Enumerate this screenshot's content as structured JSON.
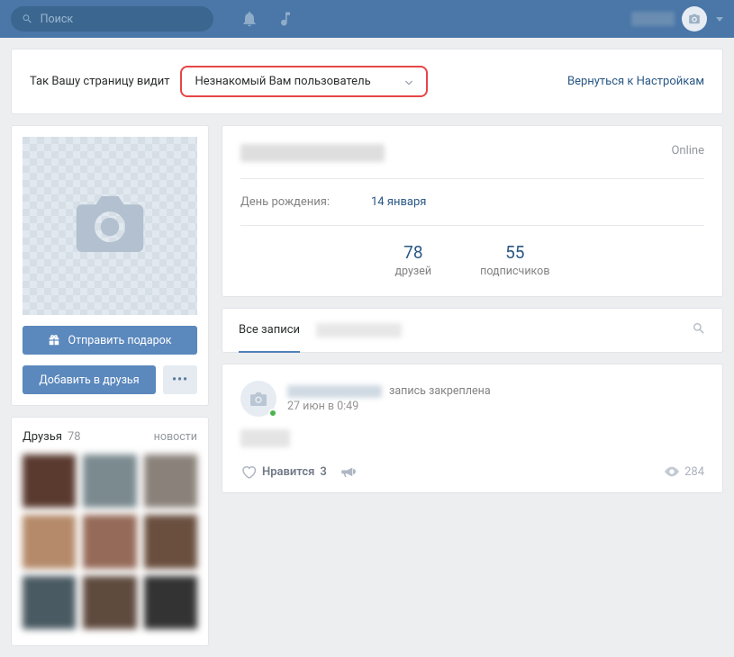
{
  "search": {
    "placeholder": "Поиск"
  },
  "notice": {
    "prefix": "Так Вашу страницу видит",
    "selected_viewer": "Незнакомый Вам пользователь",
    "back_link": "Вернуться к Настройкам"
  },
  "actions": {
    "send_gift": "Отправить подарок",
    "add_friend": "Добавить в друзья",
    "more": "•••"
  },
  "friends_block": {
    "title": "Друзья",
    "count": "78",
    "news_link": "новости",
    "cells": [
      "#5a3a2f",
      "#7a8a8f",
      "#8a817a",
      "#b48a6a",
      "#956a58",
      "#6a4f3f",
      "#4a5a62",
      "#5f4a3e",
      "#333333"
    ]
  },
  "profile": {
    "online": "Online",
    "birthday_label": "День рождения:",
    "birthday_value": "14 января",
    "stats": [
      {
        "n": "78",
        "l": "друзей"
      },
      {
        "n": "55",
        "l": "подписчиков"
      }
    ]
  },
  "wall": {
    "tab_all": "Все записи"
  },
  "post": {
    "pinned": "запись закреплена",
    "date": "27 июн в 0:49",
    "like_label": "Нравится",
    "like_count": "3",
    "views": "284"
  }
}
